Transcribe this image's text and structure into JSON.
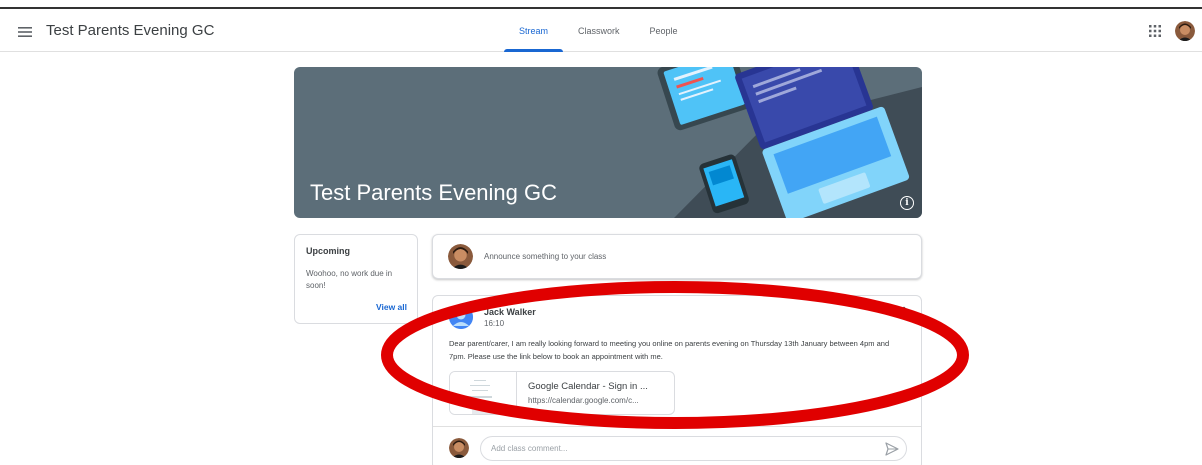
{
  "header": {
    "app_title": "Test Parents Evening GC",
    "tabs": [
      {
        "label": "Stream",
        "active": true
      },
      {
        "label": "Classwork",
        "active": false
      },
      {
        "label": "People",
        "active": false
      }
    ],
    "icons": {
      "menu": "hamburger-menu-icon",
      "apps": "apps-grid-icon",
      "account": "user-avatar"
    }
  },
  "banner": {
    "title": "Test Parents Evening GC",
    "background_color": "#5c6e79",
    "icons": {
      "info": "info-icon"
    }
  },
  "upcoming": {
    "title": "Upcoming",
    "text": "Woohoo, no work due in soon!",
    "view_all": "View all"
  },
  "announce": {
    "placeholder": "Announce something to your class"
  },
  "post": {
    "author": "Jack Walker",
    "time": "16:10",
    "body": "Dear parent/carer, I am really looking forward to meeting you online on parents evening on Thursday 13th January between 4pm and 7pm. Please use the link below to book an appointment with me.",
    "link": {
      "title": "Google Calendar - Sign in ...",
      "url": "https://calendar.google.com/c..."
    },
    "comment_placeholder": "Add class comment...",
    "icons": {
      "send": "send-icon",
      "more": "more-vert-icon"
    }
  },
  "colors": {
    "accent": "#1967d2",
    "annotation": "#e00000"
  }
}
